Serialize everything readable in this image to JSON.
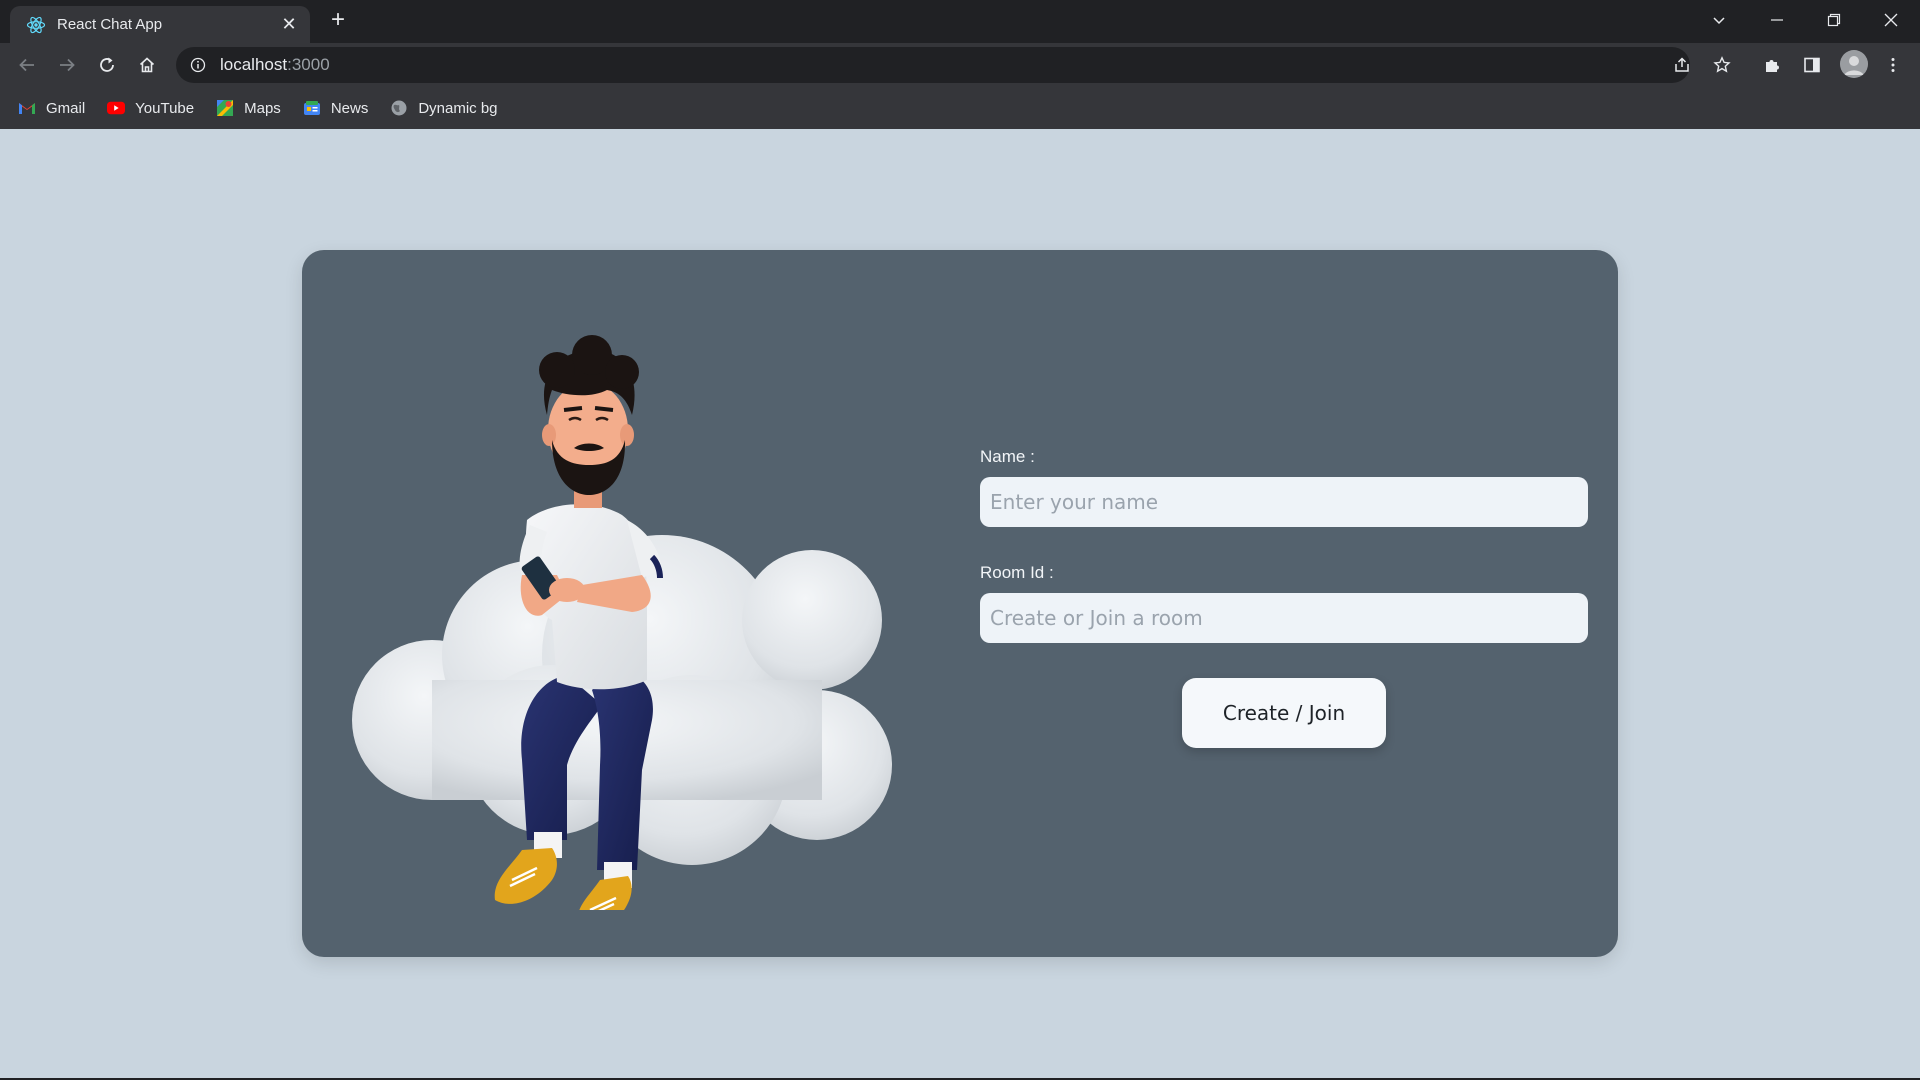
{
  "browser": {
    "tab_title": "React Chat App",
    "url_host": "localhost",
    "url_port": ":3000",
    "bookmarks": [
      {
        "label": "Gmail",
        "icon": "gmail-icon"
      },
      {
        "label": "YouTube",
        "icon": "youtube-icon"
      },
      {
        "label": "Maps",
        "icon": "maps-icon"
      },
      {
        "label": "News",
        "icon": "news-icon"
      },
      {
        "label": "Dynamic bg",
        "icon": "globe-icon"
      }
    ]
  },
  "form": {
    "name_label": "Name :",
    "name_placeholder": "Enter your name",
    "room_label": "Room Id :",
    "room_placeholder": "Create or Join a room",
    "submit_label": "Create / Join"
  },
  "colors": {
    "page_bg": "#c9d5df",
    "card_bg": "#54626e",
    "input_bg": "#eef3f8",
    "button_bg": "#f5f8fb"
  }
}
